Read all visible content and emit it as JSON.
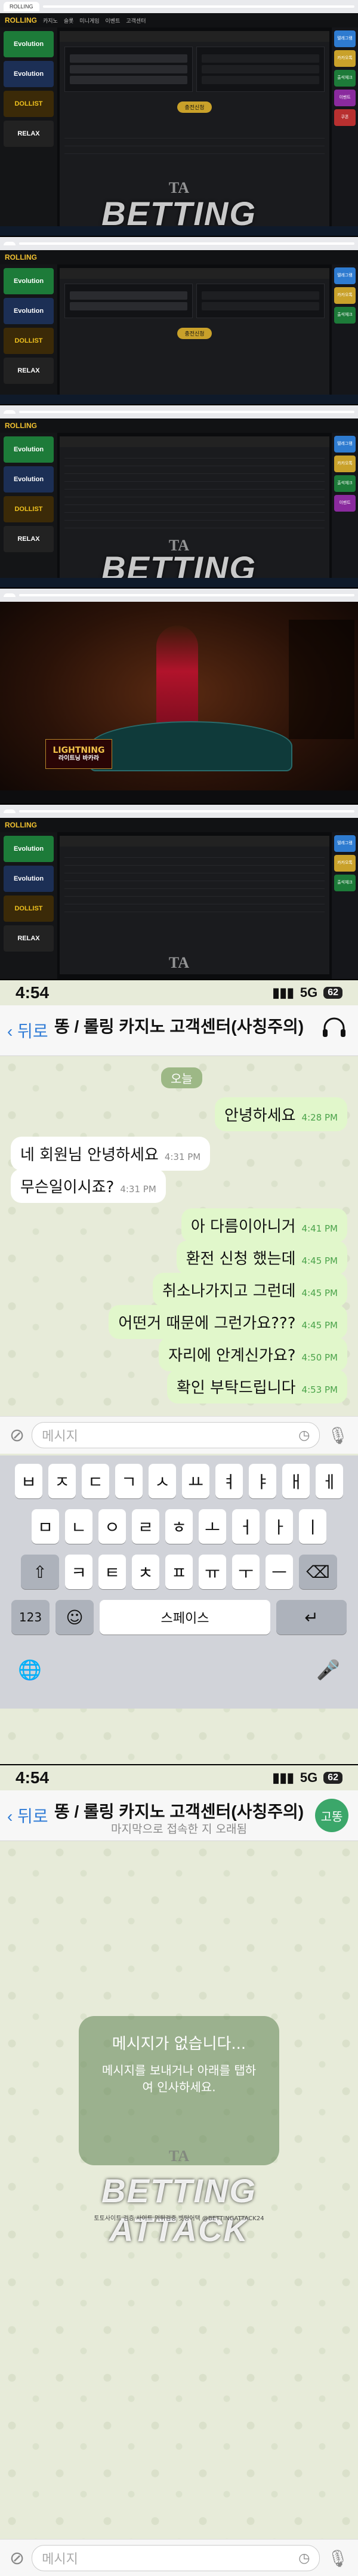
{
  "watermark": {
    "brand": "BETTING ATTACK",
    "tagline": "토토사이트 검증 사이트 먹튀검증 벳팅어택 @BETTINGATTACK24",
    "emblem": "TA"
  },
  "desktop": {
    "logo": "ROLLING",
    "nav": [
      "카지노",
      "슬롯",
      "미니게임",
      "이벤트",
      "고객센터"
    ],
    "sidebar": [
      "Evolution",
      "Evolution",
      "DOLLIST",
      "RELAX"
    ],
    "rightbar": [
      "텔레그램",
      "카카오톡",
      "출석체크",
      "이벤트",
      "쿠폰"
    ],
    "button": "충전신청",
    "casino_title": "LIGHTNING",
    "casino_sub": "라이트닝 바카라"
  },
  "chat1": {
    "status_time": "4:54",
    "net": "5G",
    "battery": "62",
    "back": "뒤로",
    "title": "똥 / 롤링 카지노 고객센터(사칭주의)",
    "day": "오늘",
    "messages": [
      {
        "dir": "out",
        "text": "안녕하세요",
        "time": "4:28 PM"
      },
      {
        "dir": "in",
        "text": "네 회원님 안녕하세요",
        "time": "4:31 PM"
      },
      {
        "dir": "in",
        "text": "무슨일이시죠?",
        "time": "4:31 PM"
      },
      {
        "dir": "out",
        "text": "아 다름이아니거",
        "time": "4:41 PM"
      },
      {
        "dir": "out",
        "text": "환전 신청 했는데",
        "time": "4:45 PM"
      },
      {
        "dir": "out",
        "text": "취소나가지고 그런데",
        "time": "4:45 PM"
      },
      {
        "dir": "out",
        "text": "어떤거 때문에 그런가요???",
        "time": "4:45 PM"
      },
      {
        "dir": "out",
        "text": "자리에 안계신가요?",
        "time": "4:50 PM"
      },
      {
        "dir": "out",
        "text": "확인 부탁드립니다",
        "time": "4:53 PM"
      }
    ],
    "input_placeholder": "메시지",
    "keyboard": {
      "row1": [
        "ㅂ",
        "ㅈ",
        "ㄷ",
        "ㄱ",
        "ㅅ",
        "ㅛ",
        "ㅕ",
        "ㅑ",
        "ㅐ",
        "ㅔ"
      ],
      "row2": [
        "ㅁ",
        "ㄴ",
        "ㅇ",
        "ㄹ",
        "ㅎ",
        "ㅗ",
        "ㅓ",
        "ㅏ",
        "ㅣ"
      ],
      "row3": [
        "ㅋ",
        "ㅌ",
        "ㅊ",
        "ㅍ",
        "ㅠ",
        "ㅜ",
        "ㅡ"
      ],
      "shift": "⇧",
      "delete": "⌫",
      "num": "123",
      "emoji": "☺",
      "space": "스페이스",
      "return": "↵",
      "globe": "🌐",
      "dictation": "🎤"
    }
  },
  "chat2": {
    "status_time": "4:54",
    "net": "5G",
    "battery": "62",
    "back": "뒤로",
    "title": "똥 / 롤링 카지노 고객센터(사칭주의)",
    "subtitle": "마지막으로 접속한 지 오래됨",
    "avatar": "고똥",
    "empty_title": "메시지가 없습니다...",
    "empty_body": "메시지를 보내거나 아래를 탭하여 인사하세요.",
    "input_placeholder": "메시지"
  },
  "colors": {
    "accent_green": "#1d7b39",
    "gold": "#c9a12a",
    "bubble_out": "#e1f7cb",
    "ios_blue": "#2f7bd6"
  }
}
